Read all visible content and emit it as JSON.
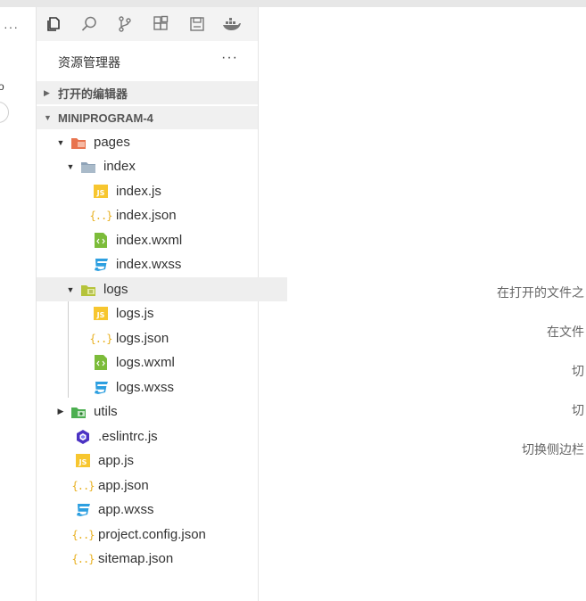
{
  "leftpane": {
    "menu": "···",
    "edge_char": "o"
  },
  "toolbar": {
    "icons": [
      "explorer-icon",
      "search-icon",
      "source-control-icon",
      "extensions-icon",
      "save-icon",
      "docker-icon"
    ]
  },
  "explorer": {
    "title": "资源管理器",
    "more": "···",
    "open_editors": "打开的编辑器",
    "project": "MINIPROGRAM-4"
  },
  "tree": [
    {
      "label": "pages",
      "icon": "pages-folder-icon"
    },
    {
      "label": "index",
      "icon": "folder-icon"
    },
    {
      "label": "index.js",
      "icon": "js-file-icon"
    },
    {
      "label": "index.json",
      "icon": "json-file-icon"
    },
    {
      "label": "index.wxml",
      "icon": "wxml-file-icon"
    },
    {
      "label": "index.wxss",
      "icon": "css-file-icon"
    },
    {
      "label": "logs",
      "icon": "logs-folder-icon"
    },
    {
      "label": "logs.js",
      "icon": "js-file-icon"
    },
    {
      "label": "logs.json",
      "icon": "json-file-icon"
    },
    {
      "label": "logs.wxml",
      "icon": "wxml-file-icon"
    },
    {
      "label": "logs.wxss",
      "icon": "css-file-icon"
    },
    {
      "label": "utils",
      "icon": "utils-folder-icon"
    },
    {
      "label": ".eslintrc.js",
      "icon": "eslint-file-icon"
    },
    {
      "label": "app.js",
      "icon": "js-file-icon"
    },
    {
      "label": "app.json",
      "icon": "json-file-icon"
    },
    {
      "label": "app.wxss",
      "icon": "css-file-icon"
    },
    {
      "label": "project.config.json",
      "icon": "json-file-icon"
    },
    {
      "label": "sitemap.json",
      "icon": "json-file-icon"
    }
  ],
  "hints": [
    "在打开的文件之",
    "在文件",
    "切",
    "切",
    "切换侧边栏"
  ],
  "colors": {
    "js": "#f7c62f",
    "json": "#e8b020",
    "wxml": "#7cbc3a",
    "css": "#2d9fe0",
    "eslint": "#4b32c3",
    "pages_folder": "#e8744f",
    "folder": "#8fa3b8"
  }
}
